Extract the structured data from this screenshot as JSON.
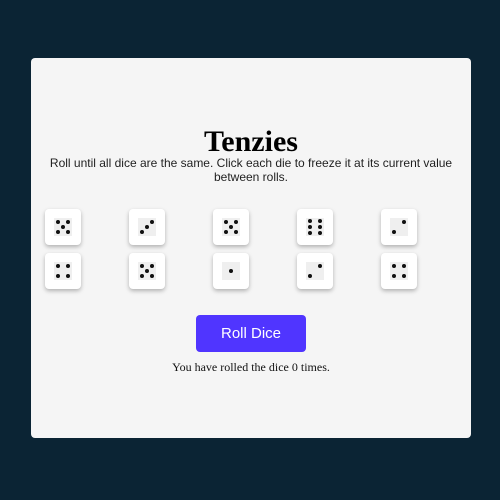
{
  "title": "Tenzies",
  "instructions": "Roll until all dice are the same. Click each die to freeze it at its current value between rolls.",
  "dice": [
    {
      "value": 5,
      "held": false
    },
    {
      "value": 3,
      "held": false
    },
    {
      "value": 5,
      "held": false
    },
    {
      "value": 6,
      "held": false
    },
    {
      "value": 2,
      "held": false
    },
    {
      "value": 4,
      "held": false
    },
    {
      "value": 5,
      "held": false
    },
    {
      "value": 1,
      "held": false
    },
    {
      "value": 2,
      "held": false
    },
    {
      "value": 4,
      "held": false
    }
  ],
  "roll_button_label": "Roll Dice",
  "roll_count_text": "You have rolled the dice 0 times.",
  "colors": {
    "background": "#0b2434",
    "panel": "#f5f5f5",
    "button": "#5035ff",
    "pip": "#111111"
  }
}
